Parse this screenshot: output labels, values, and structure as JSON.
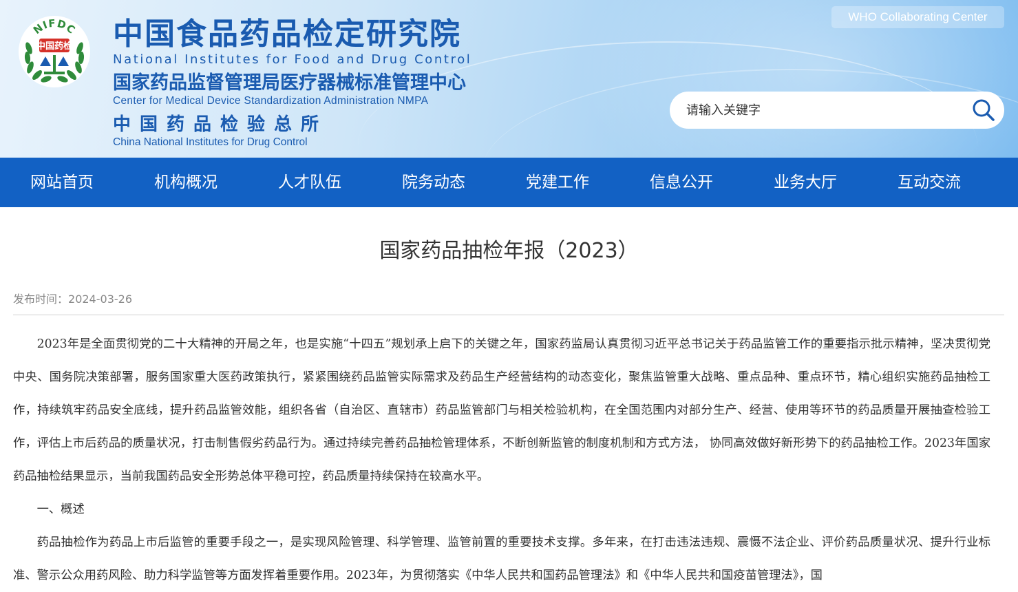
{
  "header": {
    "logo": {
      "arc_text": "NIFDC",
      "badge_text": "中国药检",
      "colors": {
        "green": "#2f8b3a",
        "red": "#d5322a",
        "blue": "#1a5bb0"
      }
    },
    "title_cn": "中国食品药品检定研究院",
    "title_en": "National Institutes for Food and Drug Control",
    "sub_cn": "国家药品监督管理局医疗器械标准管理中心",
    "sub_en": "Center for Medical Device Standardization Administration NMPA",
    "third_cn": "中国药品检验总所",
    "third_en": "China National Institutes for Drug Control",
    "who_label": "WHO Collaborating Center",
    "search": {
      "placeholder": "请输入关键字",
      "icon": "search-icon"
    }
  },
  "nav": {
    "items": [
      {
        "label": "网站首页"
      },
      {
        "label": "机构概况"
      },
      {
        "label": "人才队伍"
      },
      {
        "label": "院务动态"
      },
      {
        "label": "党建工作"
      },
      {
        "label": "信息公开"
      },
      {
        "label": "业务大厅"
      },
      {
        "label": "互动交流"
      }
    ]
  },
  "article": {
    "title": "国家药品抽检年报（2023）",
    "publish_label": "发布时间：",
    "publish_date": "2024-03-26",
    "paragraphs": [
      "2023年是全面贯彻党的二十大精神的开局之年，也是实施“十四五”规划承上启下的关键之年，国家药监局认真贯彻习近平总书记关于药品监管工作的重要指示批示精神，坚决贯彻党中央、国务院决策部署，服务国家重大医药政策执行，紧紧围绕药品监管实际需求及药品生产经营结构的动态变化，聚焦监管重大战略、重点品种、重点环节，精心组织实施药品抽检工作，持续筑牢药品安全底线，提升药品监管效能，组织各省（自治区、直辖市）药品监管部门与相关检验机构，在全国范围内对部分生产、经营、使用等环节的药品质量开展抽查检验工作，评估上市后药品的质量状况，打击制售假劣药品行为。通过持续完善药品抽检管理体系，不断创新监管的制度机制和方式方法， 协同高效做好新形势下的药品抽检工作。2023年国家药品抽检结果显示，当前我国药品安全形势总体平稳可控，药品质量持续保持在较高水平。",
      "一、概述",
      "药品抽检作为药品上市后监管的重要手段之一，是实现风险管理、科学管理、监管前置的重要技术支撑。多年来，在打击违法违规、震慑不法企业、评价药品质量状况、提升行业标准、警示公众用药风险、助力科学监管等方面发挥着重要作用。2023年，为贯彻落实《中华人民共和国药品管理法》和《中华人民共和国疫苗管理法》，国"
    ]
  },
  "colors": {
    "nav_bg": "#1261c4",
    "brand_blue": "#1a5bb0",
    "text": "#333333",
    "meta": "#888888"
  }
}
